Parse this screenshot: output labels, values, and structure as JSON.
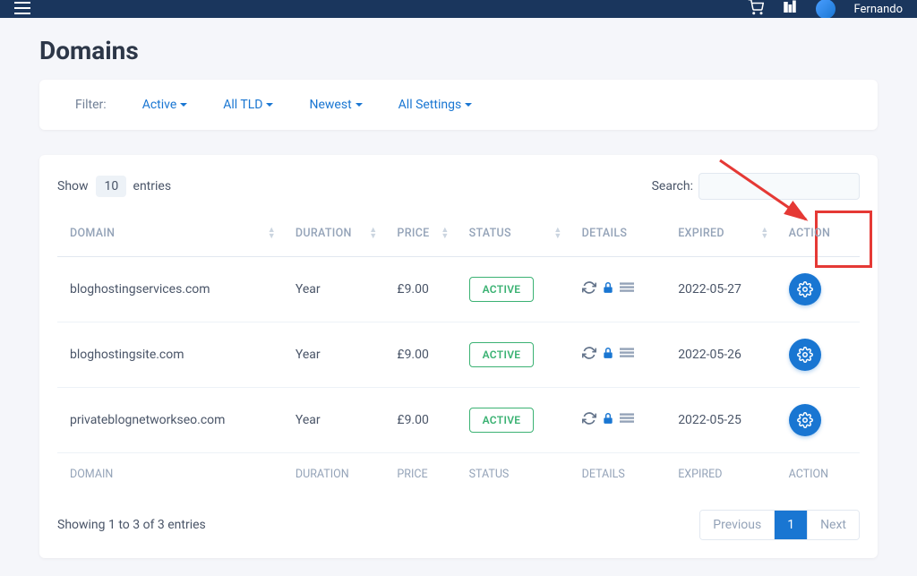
{
  "topbar": {
    "username": "Fernando"
  },
  "page": {
    "title": "Domains"
  },
  "filters": {
    "label": "Filter:",
    "status": "Active",
    "tld": "All TLD",
    "sort": "Newest",
    "settings": "All Settings"
  },
  "table": {
    "show_prefix": "Show",
    "show_suffix": "entries",
    "entries_value": "10",
    "search_label": "Search:",
    "columns": {
      "domain": "DOMAIN",
      "duration": "DURATION",
      "price": "PRICE",
      "status": "STATUS",
      "details": "DETAILS",
      "expired": "EXPIRED",
      "action": "ACTION"
    },
    "rows": [
      {
        "domain": "bloghostingservices.com",
        "duration": "Year",
        "price": "£9.00",
        "status": "ACTIVE",
        "expired": "2022-05-27"
      },
      {
        "domain": "bloghostingsite.com",
        "duration": "Year",
        "price": "£9.00",
        "status": "ACTIVE",
        "expired": "2022-05-26"
      },
      {
        "domain": "privateblognetworkseo.com",
        "duration": "Year",
        "price": "£9.00",
        "status": "ACTIVE",
        "expired": "2022-05-25"
      }
    ],
    "info": "Showing 1 to 3 of 3 entries",
    "pagination": {
      "prev": "Previous",
      "current": "1",
      "next": "Next"
    }
  }
}
